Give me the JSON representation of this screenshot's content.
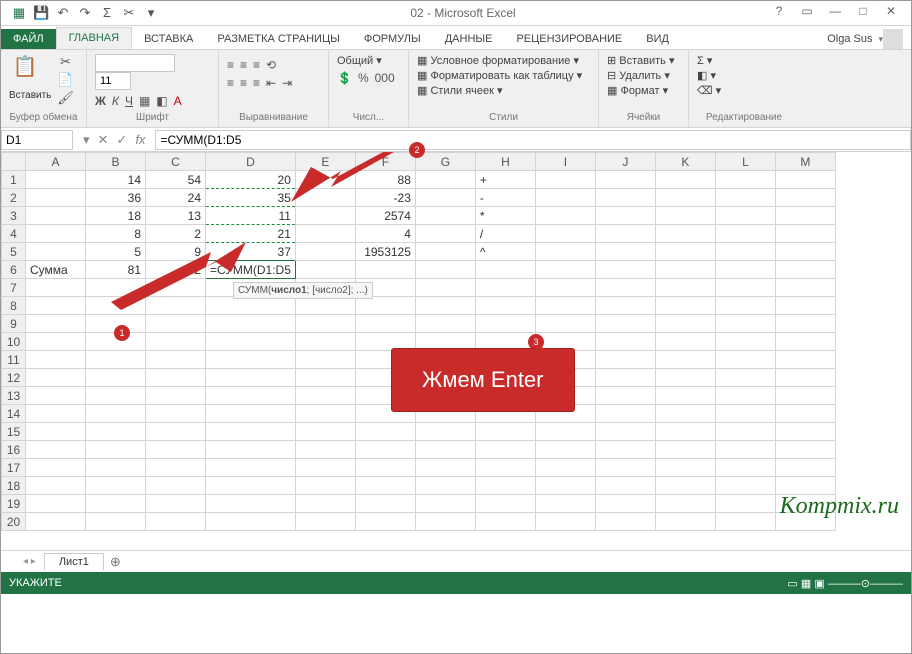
{
  "titlebar": {
    "title": "02 - Microsoft Excel",
    "user": "Olga Sus"
  },
  "tabs": {
    "file": "ФАЙЛ",
    "items": [
      "ГЛАВНАЯ",
      "ВСТАВКА",
      "РАЗМЕТКА СТРАНИЦЫ",
      "ФОРМУЛЫ",
      "ДАННЫЕ",
      "РЕЦЕНЗИРОВАНИЕ",
      "ВИД"
    ],
    "active": "ГЛАВНАЯ"
  },
  "ribbon": {
    "clipboard": {
      "paste": "Вставить",
      "label": "Буфер обмена"
    },
    "font": {
      "label": "Шрифт",
      "size": "11"
    },
    "align": {
      "label": "Выравнивание"
    },
    "number": {
      "format": "Общий",
      "label": "Числ..."
    },
    "styles": {
      "cond": "Условное форматирование",
      "table": "Форматировать как таблицу",
      "cell": "Стили ячеек",
      "label": "Стили"
    },
    "cells": {
      "insert": "Вставить",
      "delete": "Удалить",
      "format": "Формат",
      "label": "Ячейки"
    },
    "editing": {
      "label": "Редактирование"
    }
  },
  "namebox": "D1",
  "formula": "=СУММ(D1:D5",
  "columns": [
    "A",
    "B",
    "C",
    "D",
    "E",
    "F",
    "G",
    "H",
    "I",
    "J",
    "K",
    "L",
    "M"
  ],
  "rows": [
    {
      "n": 1,
      "A": "",
      "B": "14",
      "C": "54",
      "D": "20",
      "E": "",
      "F": "88",
      "G": "",
      "H": "+"
    },
    {
      "n": 2,
      "A": "",
      "B": "36",
      "C": "24",
      "D": "35",
      "E": "",
      "F": "-23",
      "G": "",
      "H": "-"
    },
    {
      "n": 3,
      "A": "",
      "B": "18",
      "C": "13",
      "D": "11",
      "E": "",
      "F": "2574",
      "G": "",
      "H": "*"
    },
    {
      "n": 4,
      "A": "",
      "B": "8",
      "C": "2",
      "D": "21",
      "E": "",
      "F": "4",
      "G": "",
      "H": "/"
    },
    {
      "n": 5,
      "A": "",
      "B": "5",
      "C": "9",
      "D": "37",
      "E": "",
      "F": "1953125",
      "G": "",
      "H": "^"
    },
    {
      "n": 6,
      "A": "Сумма",
      "B": "81",
      "C": "102",
      "D": "=СУММ(D1:D5",
      "E": "",
      "F": "",
      "G": "",
      "H": ""
    }
  ],
  "blank_rows": [
    7,
    8,
    9,
    10,
    11,
    12,
    13,
    14,
    15,
    16,
    17,
    18,
    19,
    20
  ],
  "tooltip_html": "СУММ(число1; [число2]; ...)",
  "hint": "Жмем Enter",
  "badges": {
    "b1": "1",
    "b2": "2",
    "b3": "3"
  },
  "sheet_tab": "Лист1",
  "status": "УКАЖИТЕ",
  "watermark": "Kompmix.ru"
}
